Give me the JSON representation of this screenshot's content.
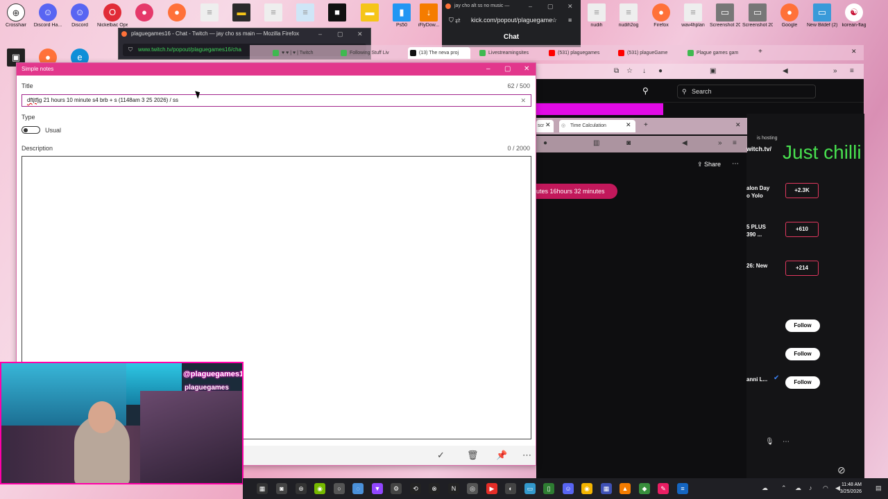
{
  "desktop": {
    "icons": [
      {
        "label": "Crosshair",
        "icon": "crosshair-icon",
        "color": "#333333"
      },
      {
        "label": "Discord Ha...",
        "icon": "discord-icon",
        "color": "#5865f2"
      },
      {
        "label": "Discord",
        "icon": "discord-icon",
        "color": "#5865f2"
      },
      {
        "label": "Nickelbac Opera G...",
        "icon": "opera-icon",
        "color": "#e12b37"
      },
      {
        "label": "",
        "icon": "location-pin-icon",
        "color": "#e5396a"
      },
      {
        "label": "",
        "icon": "firefox-icon",
        "color": "#ff7139"
      },
      {
        "label": "nudih",
        "icon": "document-icon",
        "color": "#dddddd"
      },
      {
        "label": "nudih2og",
        "icon": "document-icon",
        "color": "#dddddd"
      },
      {
        "label": "Firefox",
        "icon": "firefox-icon",
        "color": "#ff7139"
      },
      {
        "label": "wav4hplan",
        "icon": "document-icon",
        "color": "#dddddd"
      },
      {
        "label": "Screenshot 2025-12-2...",
        "icon": "image-icon",
        "color": "#777777"
      },
      {
        "label": "Screenshot 2025-07-...",
        "icon": "image-icon",
        "color": "#777777"
      },
      {
        "label": "Google",
        "icon": "firefox-icon",
        "color": "#ff7139"
      },
      {
        "label": "New Bitdef (2)",
        "icon": "image-icon",
        "color": "#3a9ad9"
      },
      {
        "label": "korean-flag",
        "icon": "korean-flag-icon",
        "color": "#ffffff"
      },
      {
        "label": "Ps50",
        "icon": "app-icon",
        "color": "#2196f3"
      },
      {
        "label": "iFlyDow...",
        "icon": "download-icon",
        "color": "#f57c00"
      }
    ]
  },
  "twitch_window": {
    "title": "plaguegames16 - Chat - Twitch — jay cho ss main — Mozilla Firefox",
    "url": "www.twitch.tv/popout/plaguegames16/cha"
  },
  "kick_window": {
    "title": "jay cho alt ss no music —",
    "url": "kick.com/popout/plaguegame",
    "chat_label": "Chat"
  },
  "browser_tabs": [
    {
      "label": "♥ ♥ | ♥ | Twitch",
      "color": "#3fb950"
    },
    {
      "label": "Following Stuff Liv",
      "color": "#3fb950"
    },
    {
      "label": "(13) The neva proj",
      "color": "#111111"
    },
    {
      "label": "Livestreamingsites",
      "color": "#3fb950"
    },
    {
      "label": "(531) plaguegames",
      "color": "#ff0000"
    },
    {
      "label": "(531) plagueGame",
      "color": "#ff0000"
    },
    {
      "label": "Plague games gam",
      "color": "#3fb950"
    }
  ],
  "kick_page": {
    "search_placeholder": "Search",
    "hosting_text": "is hosting",
    "twitch_url": "witch.tv/",
    "overlay_text": "Just chilli",
    "share_label": "Share",
    "timer_text": "utes 16hours 32 minutes",
    "side_items": [
      {
        "text": "alon Day\no Yolo",
        "badge": "+2.3K"
      },
      {
        "text": "5 PLUS\n390 ...",
        "badge": "+610"
      },
      {
        "text": "26: New",
        "badge": "+214"
      }
    ],
    "follow_label": "Follow",
    "follow_user": "anni L...",
    "inner_tab_label": "Time Calculation",
    "inner_tab_left": "scr"
  },
  "notes_window": {
    "window_title": "Simple notes",
    "title_label": "Title",
    "title_counter": "62 / 500",
    "title_value_misspelled": "dftjtfjg",
    "title_value_rest": " 21 hours 10 minute s4 brb + s (1148am 3 25 2026) / ss",
    "type_label": "Type",
    "type_toggle_label": "Usual",
    "description_label": "Description",
    "description_counter": "0 / 2000",
    "description_value": "",
    "footer_icons": [
      "checkmark-icon",
      "trash-icon",
      "pin-icon",
      "more-icon"
    ]
  },
  "webcam": {
    "name_line1": "@plaguegames16",
    "name_line2": "plaguegames"
  },
  "taskbar": {
    "time": "11:48 AM",
    "date": "3/25/2026"
  }
}
